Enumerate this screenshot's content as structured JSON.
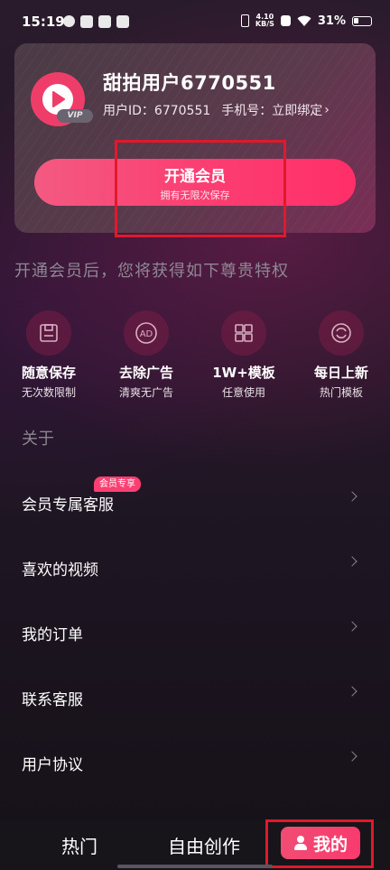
{
  "status_bar": {
    "time": "15:19",
    "network_speed_value": "4.10",
    "network_speed_unit": "KB/S",
    "battery": "31%"
  },
  "profile": {
    "username": "甜拍用户6770551",
    "user_id_label": "用户ID：",
    "user_id": "6770551",
    "phone_label": "手机号：",
    "phone_value": "立即绑定",
    "vip_badge": "VIP"
  },
  "vip_button": {
    "title": "开通会员",
    "subtitle": "拥有无限次保存"
  },
  "privileges": {
    "heading": "开通会员后，您将获得如下尊贵特权",
    "items": [
      {
        "icon": "save-icon",
        "title": "随意保存",
        "subtitle": "无次数限制"
      },
      {
        "icon": "ad-icon",
        "title": "去除广告",
        "subtitle": "清爽无广告"
      },
      {
        "icon": "template-icon",
        "title": "1W+模板",
        "subtitle": "任意使用"
      },
      {
        "icon": "refresh-icon",
        "title": "每日上新",
        "subtitle": "热门模板"
      }
    ]
  },
  "about": {
    "heading": "关于",
    "items": [
      {
        "label": "会员专属客服",
        "tag": "会员专享"
      },
      {
        "label": "喜欢的视频"
      },
      {
        "label": "我的订单"
      },
      {
        "label": "联系客服"
      },
      {
        "label": "用户协议"
      }
    ]
  },
  "bottom_nav": {
    "hot": "热门",
    "create": "自由创作",
    "mine": "我的"
  },
  "colors": {
    "accent": "#fb3f73",
    "highlight": "#e0192b"
  }
}
